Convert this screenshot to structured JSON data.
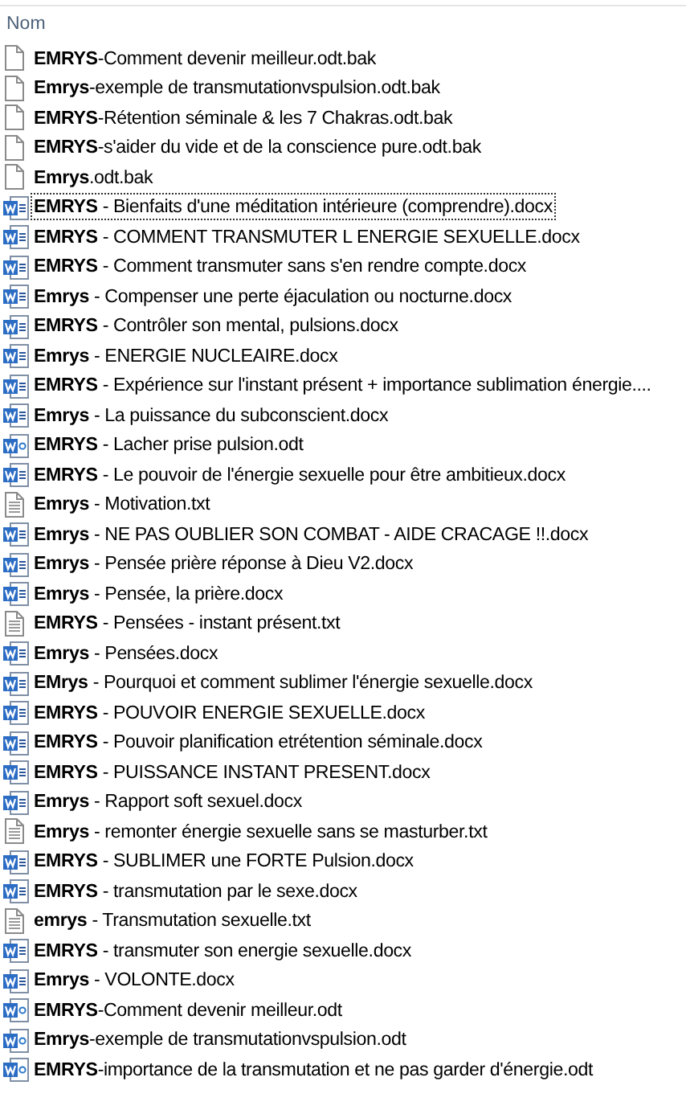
{
  "header": {
    "column": "Nom"
  },
  "files": [
    {
      "name": "**EMRYS**-Comment devenir meilleur.odt.bak",
      "kind": "blank",
      "focused": false
    },
    {
      "name": "**Emrys**-exemple de transmutationvspulsion.odt.bak",
      "kind": "blank",
      "focused": false
    },
    {
      "name": "**EMRYS**-Rétention séminale & les 7 Chakras.odt.bak",
      "kind": "blank",
      "focused": false
    },
    {
      "name": "**EMRYS**-s'aider du vide et de la conscience pure.odt.bak",
      "kind": "blank",
      "focused": false
    },
    {
      "name": "**Emrys**.odt.bak",
      "kind": "blank",
      "focused": false
    },
    {
      "name": "**EMRYS** - Bienfaits d'une méditation intérieure (comprendre).docx",
      "kind": "docx",
      "focused": true
    },
    {
      "name": "**EMRYS** - COMMENT TRANSMUTER L ENERGIE SEXUELLE.docx",
      "kind": "docx",
      "focused": false
    },
    {
      "name": "**EMRYS** - Comment transmuter sans s'en rendre compte.docx",
      "kind": "docx",
      "focused": false
    },
    {
      "name": "**Emrys** - Compenser une perte éjaculation ou nocturne.docx",
      "kind": "docx",
      "focused": false
    },
    {
      "name": "**EMRYS** - Contrôler son mental, pulsions.docx",
      "kind": "docx",
      "focused": false
    },
    {
      "name": "**Emrys** - ENERGIE NUCLEAIRE.docx",
      "kind": "docx",
      "focused": false
    },
    {
      "name": "**EMRYS** - Expérience sur l'instant présent + importance sublimation énergie....",
      "kind": "docx",
      "focused": false
    },
    {
      "name": "**Emrys** - La puissance du subconscient.docx",
      "kind": "docx",
      "focused": false
    },
    {
      "name": "**EMRYS** - Lacher prise pulsion.odt",
      "kind": "odt",
      "focused": false
    },
    {
      "name": "**EMRYS** - Le pouvoir de l'énergie sexuelle pour être ambitieux.docx",
      "kind": "docx",
      "focused": false
    },
    {
      "name": "**Emrys** - Motivation.txt",
      "kind": "txt",
      "focused": false
    },
    {
      "name": "**Emrys** - NE PAS OUBLIER SON COMBAT - AIDE CRACAGE !!.docx",
      "kind": "docx",
      "focused": false
    },
    {
      "name": "**Emrys** - Pensée prière réponse à Dieu V2.docx",
      "kind": "docx",
      "focused": false
    },
    {
      "name": "**Emrys** - Pensée, la prière.docx",
      "kind": "docx",
      "focused": false
    },
    {
      "name": "**EMRYS** - Pensées - instant présent.txt",
      "kind": "txt",
      "focused": false
    },
    {
      "name": "**Emrys** - Pensées.docx",
      "kind": "docx",
      "focused": false
    },
    {
      "name": "**EMrys** - Pourquoi et comment sublimer l'énergie sexuelle.docx",
      "kind": "docx",
      "focused": false
    },
    {
      "name": "**EMRYS** - POUVOIR ENERGIE SEXUELLE.docx",
      "kind": "docx",
      "focused": false
    },
    {
      "name": "**EMRYS** - Pouvoir planification etrétention séminale.docx",
      "kind": "docx",
      "focused": false
    },
    {
      "name": "**EMRYS** - PUISSANCE INSTANT PRESENT.docx",
      "kind": "docx",
      "focused": false
    },
    {
      "name": "**Emrys** - Rapport soft sexuel.docx",
      "kind": "docx",
      "focused": false
    },
    {
      "name": "**Emrys** - remonter énergie sexuelle sans se masturber.txt",
      "kind": "txt",
      "focused": false
    },
    {
      "name": "**EMRYS** - SUBLIMER une FORTE Pulsion.docx",
      "kind": "docx",
      "focused": false
    },
    {
      "name": "**EMRYS** - transmutation par le sexe.docx",
      "kind": "docx",
      "focused": false
    },
    {
      "name": "**emrys** - Transmutation sexuelle.txt",
      "kind": "txt",
      "focused": false
    },
    {
      "name": "**EMRYS** - transmuter son energie sexuelle.docx",
      "kind": "docx",
      "focused": false
    },
    {
      "name": "**Emrys** - VOLONTE.docx",
      "kind": "docx",
      "focused": false
    },
    {
      "name": "**EMRYS**-Comment devenir meilleur.odt",
      "kind": "odt",
      "focused": false
    },
    {
      "name": "**Emrys**-exemple de transmutationvspulsion.odt",
      "kind": "odt",
      "focused": false
    },
    {
      "name": "**EMRYS**-importance de la transmutation et ne pas garder d'énergie.odt",
      "kind": "odt",
      "focused": false
    }
  ]
}
